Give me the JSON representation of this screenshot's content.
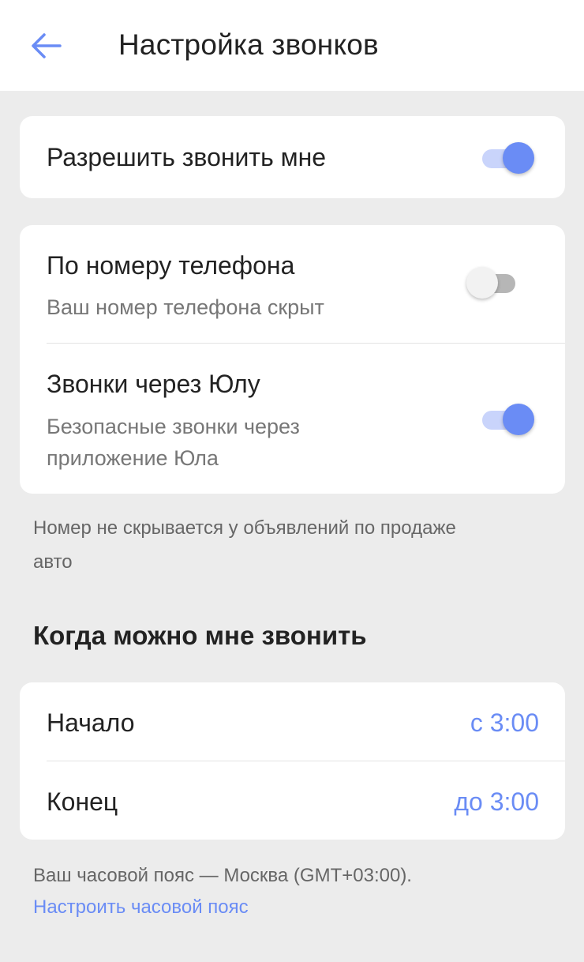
{
  "header": {
    "title": "Настройка звонков"
  },
  "allow_calls": {
    "label": "Разрешить звонить мне",
    "enabled": true
  },
  "options": [
    {
      "title": "По номеру телефона",
      "subtitle": "Ваш номер телефона скрыт",
      "enabled": false
    },
    {
      "title": "Звонки через Юлу",
      "subtitle_line1": "Безопасные звонки через",
      "subtitle_line2": "приложение Юла",
      "enabled": true
    }
  ],
  "note": {
    "line1": "Номер не скрывается у объявлений по продаже",
    "line2": "авто"
  },
  "schedule": {
    "title": "Когда можно мне звонить",
    "start_label": "Начало",
    "start_value": "с 3:00",
    "end_label": "Конец",
    "end_value": "до 3:00"
  },
  "timezone": {
    "text": "Ваш часовой пояс — Москва (GMT+03:00).",
    "link": "Настроить часовой пояс"
  },
  "colors": {
    "accent": "#6a8cf5",
    "background": "#ececec"
  }
}
